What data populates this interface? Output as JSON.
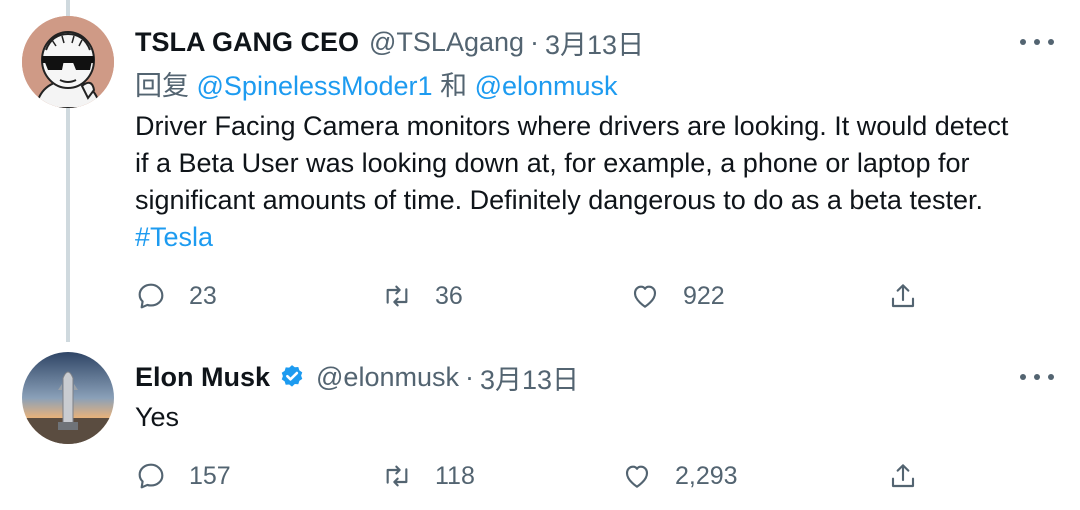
{
  "tweet1": {
    "name": "TSLA GANG CEO",
    "handle": "@TSLAgang",
    "separator": "·",
    "time": "3月13日",
    "reply_prefix": "回复",
    "reply_mention_1": "@SpinelessModer1",
    "reply_and": "和",
    "reply_mention_2": "@elonmusk",
    "text_lines": [
      "Driver Facing Camera monitors where drivers are looking. It would detect",
      "if a Beta User was looking down at, for example, a phone or laptop for",
      "significant amounts of time. Definitely dangerous to do as a beta tester."
    ],
    "hashtag": "#Tesla",
    "replies": "23",
    "retweets": "36",
    "likes": "922"
  },
  "tweet2": {
    "name": "Elon Musk",
    "handle": "@elonmusk",
    "separator": "·",
    "time": "3月13日",
    "text": "Yes",
    "replies": "157",
    "retweets": "118",
    "likes": "2,293"
  },
  "icons": {
    "reply": "comment-icon",
    "retweet": "retweet-icon",
    "like": "heart-icon",
    "share": "share-icon",
    "more": "more-icon",
    "verified": "verified-badge-icon"
  },
  "colors": {
    "link": "#1d9bf0",
    "secondary_text": "#536471",
    "thread_line": "#cfd9de"
  }
}
